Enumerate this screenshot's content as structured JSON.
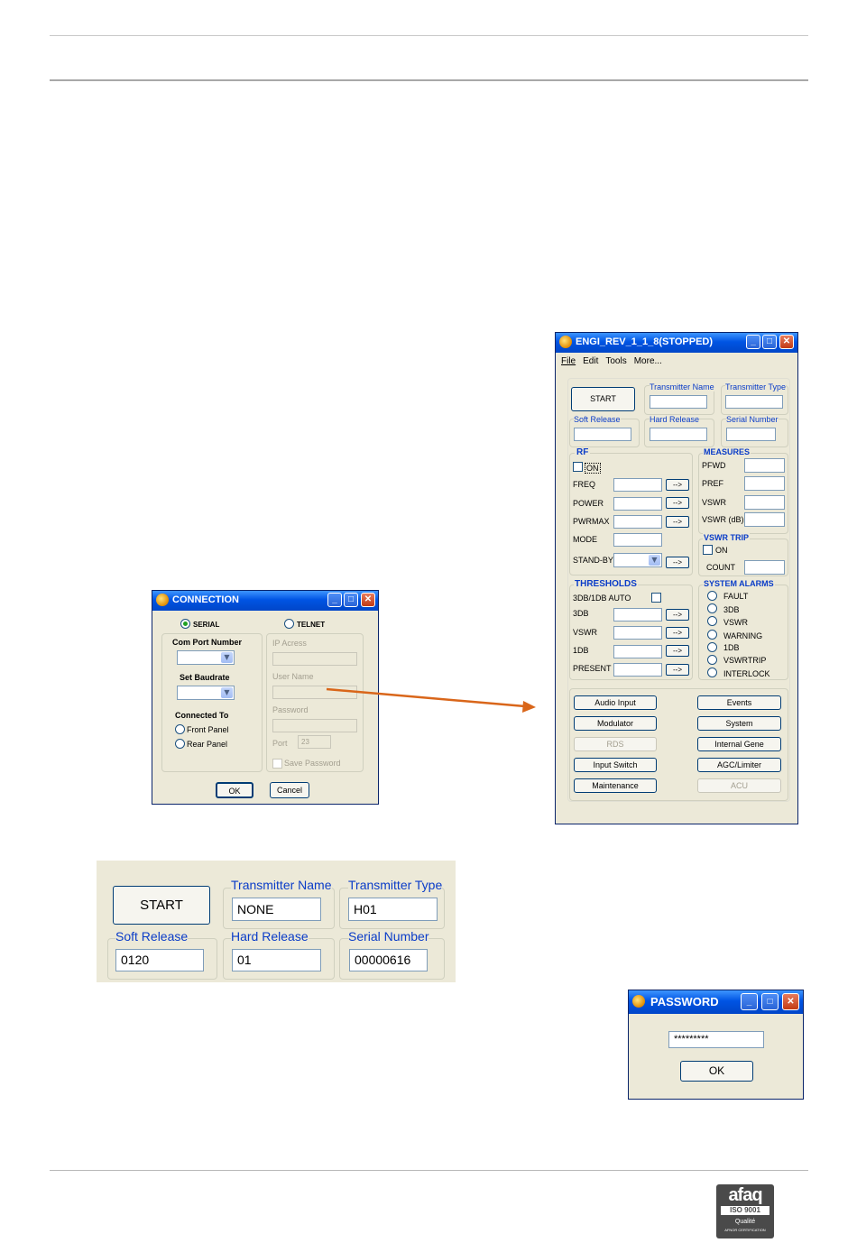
{
  "main_window": {
    "title": "ENGI_REV_1_1_8(STOPPED)",
    "menu": [
      "File",
      "Edit",
      "Tools",
      "More..."
    ],
    "start_label": "START",
    "transmitter_name_label": "Transmitter Name",
    "transmitter_type_label": "Transmitter Type",
    "soft_release_label": "Soft Release",
    "hard_release_label": "Hard Release",
    "serial_number_label": "Serial Number",
    "rf": {
      "title": "RF",
      "on_label": "ON",
      "freq_label": "FREQ",
      "power_label": "POWER",
      "pwrmax_label": "PWRMAX",
      "mode_label": "MODE",
      "standby_label": "STAND-BY",
      "arrow_label": "-->"
    },
    "measures": {
      "title": "MEASURES",
      "pfwd_label": "PFWD",
      "pref_label": "PREF",
      "vswr_label": "VSWR",
      "vswr_db_label": "VSWR (dB)"
    },
    "vswr_trip": {
      "title": "VSWR TRIP",
      "on_label": "ON",
      "count_label": "COUNT"
    },
    "thresholds": {
      "title": "THRESHOLDS",
      "auto_label": "3DB/1DB AUTO",
      "db3_label": "3DB",
      "vswr_label": "VSWR",
      "db1_label": "1DB",
      "present_label": "PRESENT"
    },
    "system_alarms": {
      "title": "SYSTEM ALARMS",
      "items": [
        "FAULT",
        "3DB",
        "VSWR",
        "WARNING",
        "1DB",
        "VSWRTRIP",
        "INTERLOCK"
      ]
    },
    "buttons_left": [
      "Audio Input",
      "Modulator",
      "RDS",
      "Input Switch",
      "Maintenance"
    ],
    "buttons_right": [
      "Events",
      "System",
      "Internal Gene",
      "AGC/Limiter",
      "ACU"
    ]
  },
  "connection_window": {
    "title": "CONNECTION",
    "serial_label": "SERIAL",
    "telnet_label": "TELNET",
    "com_port_label": "Com Port Number",
    "baudrate_label": "Set Baudrate",
    "connected_to_label": "Connected To",
    "front_panel_label": "Front Panel",
    "rear_panel_label": "Rear Panel",
    "ip_label": "IP Acress",
    "user_label": "User Name",
    "password_label": "Password",
    "port_label": "Port",
    "port_value": "23",
    "save_password_label": "Save Password",
    "ok_label": "OK",
    "cancel_label": "Cancel"
  },
  "zoom_panel": {
    "start_label": "START",
    "transmitter_name_label": "Transmitter Name",
    "transmitter_name_value": "NONE",
    "transmitter_type_label": "Transmitter Type",
    "transmitter_type_value": "H01",
    "soft_release_label": "Soft Release",
    "soft_release_value": "0120",
    "hard_release_label": "Hard Release",
    "hard_release_value": "01",
    "serial_number_label": "Serial Number",
    "serial_number_value": "00000616"
  },
  "password_window": {
    "title": "PASSWORD",
    "value": "*********",
    "ok_label": "OK"
  },
  "logo": {
    "brand": "afaq",
    "iso": "ISO 9001",
    "qualite": "Qualité",
    "certification": "AFNOR CERTIFICATION"
  },
  "colors": {
    "titlebar": "#0054e3",
    "window_bg": "#ece9d8",
    "label_blue": "#0a3cc8",
    "arrow": "#d9661a"
  }
}
